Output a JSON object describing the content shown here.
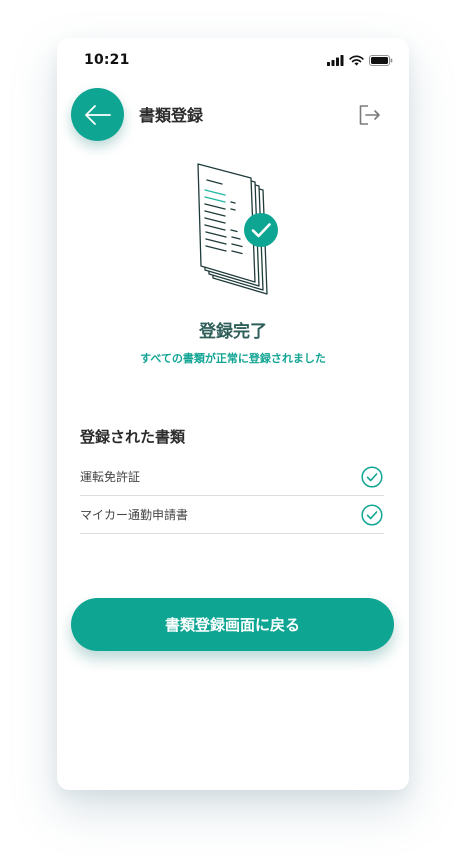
{
  "status_bar": {
    "time": "10:21",
    "icons": [
      "signal-icon",
      "wifi-icon",
      "battery-icon"
    ]
  },
  "header": {
    "title": "書類登録",
    "back_icon": "arrow-left-icon",
    "logout_icon": "logout-icon"
  },
  "completion": {
    "illustration": "document-stack-check-icon",
    "title": "登録完了",
    "subtitle": "すべての書類が正常に登録されました"
  },
  "registered": {
    "heading": "登録された書類",
    "items": [
      {
        "label": "運転免許証",
        "icon": "check-circle-icon"
      },
      {
        "label": "マイカー通勤申請書",
        "icon": "check-circle-icon"
      }
    ]
  },
  "actions": {
    "return_label": "書類登録画面に戻る"
  },
  "colors": {
    "accent": "#0fa593",
    "title_text": "#2f5f5a",
    "body_text": "#2b2b2b"
  }
}
